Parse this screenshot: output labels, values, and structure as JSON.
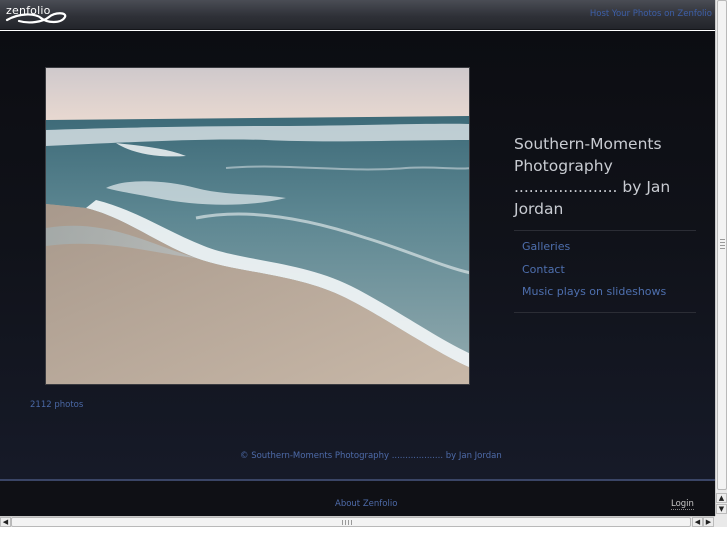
{
  "header": {
    "logo_text": "zenfolio",
    "host_link": "Host Your Photos on Zenfolio"
  },
  "site": {
    "title": "Southern-Moments Photography ..................... by Jan Jordan"
  },
  "nav": {
    "items": [
      {
        "label": "Galleries"
      },
      {
        "label": "Contact"
      },
      {
        "label": "Music plays on slideshows"
      }
    ]
  },
  "gallery": {
    "photo_count": "2112 photos",
    "featured_photo": "ocean-waves-beach-photo"
  },
  "copyright": "© Southern-Moments Photography ................... by Jan Jordan",
  "footer": {
    "about": "About Zenfolio",
    "login": "Login"
  },
  "colors": {
    "link": "#4e6fae",
    "background": "#0f1117",
    "title_text": "#c9ccd2"
  }
}
